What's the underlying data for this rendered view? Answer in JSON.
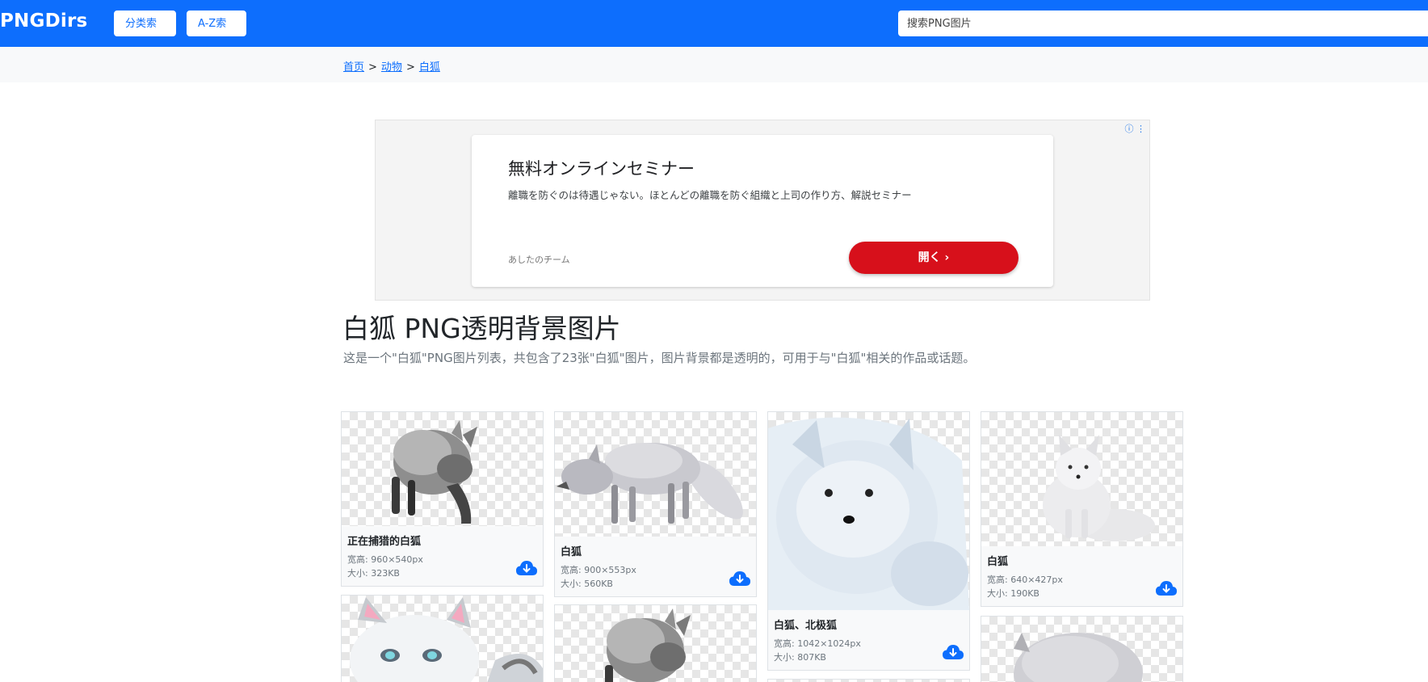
{
  "navbar": {
    "brand": "PNGDirs",
    "buttons": [
      "分类索引",
      "A-Z索引"
    ],
    "search_placeholder": "搜索PNG图片"
  },
  "breadcrumb": {
    "items": [
      "首页",
      "动物",
      "白狐"
    ],
    "separator": ">"
  },
  "ad": {
    "title": "無料オンラインセミナー",
    "description": "離職を防ぐのは待遇じゃない。ほとんどの離職を防ぐ組織と上司の作り方、解説セミナー",
    "sponsor": "あしたのチーム",
    "button": "開く ›"
  },
  "page": {
    "title": "白狐 PNG透明背景图片",
    "description": "这是一个\"白狐\"PNG图片列表，共包含了23张\"白狐\"图片，图片背景都是透明的，可用于与\"白狐\"相关的作品或话题。"
  },
  "cards": [
    {
      "title": "正在捕猎的白狐",
      "dims_label": "宽高: 960×540px",
      "size_label": "大小: 323KB"
    },
    {
      "title": "白狐",
      "dims_label": "宽高: 900×553px",
      "size_label": "大小: 560KB"
    },
    {
      "title": "白狐、北极狐",
      "dims_label": "宽高: 1042×1024px",
      "size_label": "大小: 807KB"
    },
    {
      "title": "白狐",
      "dims_label": "宽高: 640×427px",
      "size_label": "大小: 190KB"
    }
  ],
  "colors": {
    "primary": "#0d6efd",
    "ad_button": "#d7101b"
  },
  "icons": {
    "download": "cloud-download-icon"
  }
}
